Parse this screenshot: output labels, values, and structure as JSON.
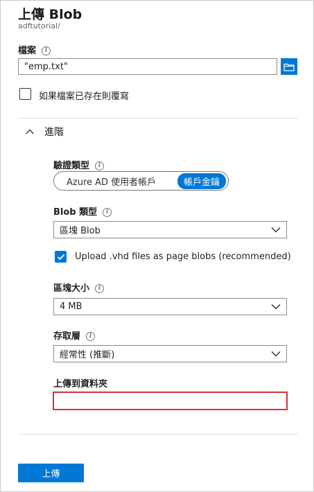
{
  "panel": {
    "title": "上傳 Blob",
    "subtitle": "adftutorial/"
  },
  "file": {
    "label": "檔案",
    "value": "\"emp.txt\""
  },
  "overwrite": {
    "label": "如果檔案已存在則覆寫",
    "checked": false
  },
  "advanced": {
    "label": "進階",
    "expanded": true
  },
  "auth": {
    "label": "驗證類型",
    "options": [
      "Azure AD 使用者帳戶",
      "帳戶金鑰"
    ],
    "selected": "帳戶金鑰"
  },
  "blob_type": {
    "label": "Blob 類型",
    "value": "區塊 Blob"
  },
  "vhd": {
    "label": "Upload .vhd files as page blobs (recommended)",
    "checked": true
  },
  "block_size": {
    "label": "區塊大小",
    "value": "4 MB"
  },
  "tier": {
    "label": "存取層",
    "value": "經常性 (推斷)"
  },
  "folder": {
    "label": "上傳到資料夾",
    "value": ""
  },
  "footer": {
    "upload_label": "上傳"
  },
  "colors": {
    "accent": "#0078d4",
    "error_border": "#d13438"
  }
}
